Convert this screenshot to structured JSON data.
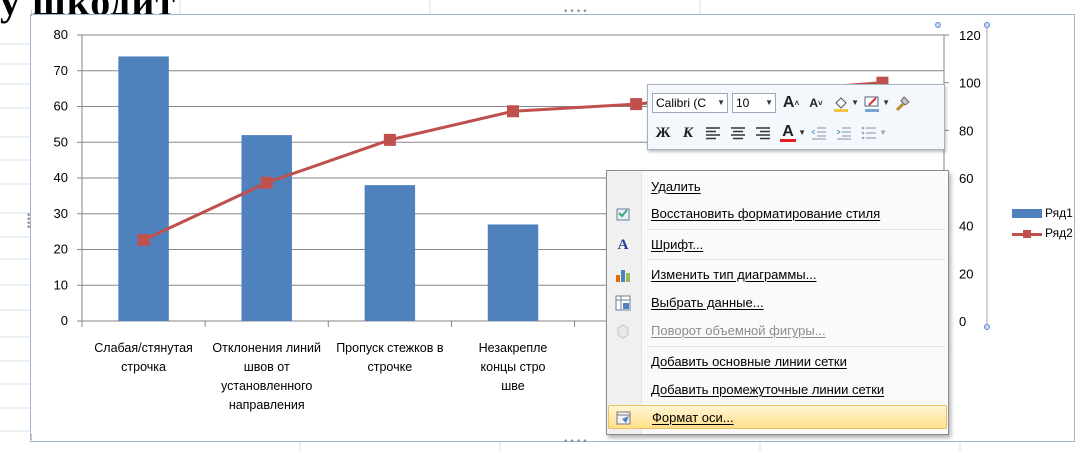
{
  "document": {
    "title_fragment": "у шкодит"
  },
  "chart": {
    "y1_ticks": [
      "80",
      "70",
      "60",
      "50",
      "40",
      "30",
      "20",
      "10",
      "0"
    ],
    "y2_ticks": [
      "120",
      "100",
      "80",
      "60",
      "40",
      "20",
      "0"
    ],
    "categories": [
      "Слабая/стянутая строчка",
      "Отклонения линий швов от установленного направления",
      "Пропуск стежков в строчке",
      "Незакрепле... концы стро... шве"
    ],
    "category_labels": [
      [
        "Слабая/стянутая",
        "строчка"
      ],
      [
        "Отклонения линий",
        "швов от",
        "установленного",
        "направления"
      ],
      [
        "Пропуск стежков в",
        "строчке"
      ],
      [
        "Незакрепле",
        "концы стро",
        "шве"
      ]
    ],
    "legend": {
      "series1": "Ряд1",
      "series2": "Ряд2"
    }
  },
  "chart_data": {
    "type": "bar",
    "categories": [
      "Слабая/стянутая строчка",
      "Отклонения линий швов от установленного направления",
      "Пропуск стежков в строчке",
      "Незакрепле... концы стро... шве",
      "",
      "",
      ""
    ],
    "series": [
      {
        "name": "Ряд1",
        "type": "bar",
        "axis": "left",
        "values": [
          74,
          52,
          38,
          27,
          null,
          null,
          null
        ]
      },
      {
        "name": "Ряд2",
        "type": "line",
        "axis": "right",
        "values": [
          34,
          58,
          76,
          88,
          91,
          96,
          100
        ]
      }
    ],
    "ylim_left": [
      0,
      80
    ],
    "ylim_right": [
      0,
      120
    ],
    "grid": true,
    "legend": "right",
    "colors": {
      "Ряд1": "#4f81bd",
      "Ряд2": "#c0504d"
    }
  },
  "mini_toolbar": {
    "font_name": "Calibri (С",
    "font_size": "10",
    "grow_font": "A",
    "shrink_font": "A",
    "bold": "Ж",
    "italic": "К",
    "font_color_letter": "A"
  },
  "context_menu": {
    "items": [
      {
        "label": "Удалить",
        "icon": "none",
        "enabled": true
      },
      {
        "label": "Восстановить форматирование стиля",
        "icon": "reset-style-icon",
        "enabled": true
      },
      {
        "label": "Шрифт...",
        "icon": "font-icon",
        "enabled": true
      },
      {
        "label": "Изменить тип диаграммы...",
        "icon": "chart-type-icon",
        "enabled": true
      },
      {
        "label": "Выбрать данные...",
        "icon": "select-data-icon",
        "enabled": true
      },
      {
        "label": "Поворот объемной фигуры...",
        "icon": "3d-rotation-icon",
        "enabled": false
      },
      {
        "label": "Добавить основные линии сетки",
        "icon": "none",
        "enabled": true
      },
      {
        "label": "Добавить промежуточные линии сетки",
        "icon": "none",
        "enabled": true
      },
      {
        "label": "Формат оси...",
        "icon": "format-axis-icon",
        "enabled": true,
        "selected": true
      }
    ]
  }
}
